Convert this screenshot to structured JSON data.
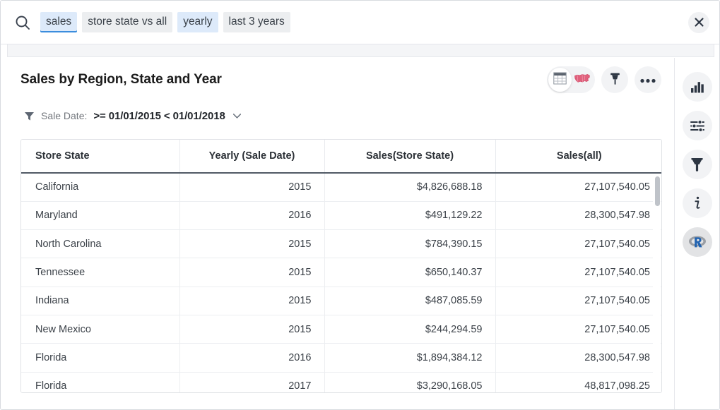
{
  "search": {
    "icon": "search-icon",
    "chips": [
      {
        "label": "sales",
        "style": "active"
      },
      {
        "label": "store state vs all",
        "style": "gray"
      },
      {
        "label": "yearly",
        "style": "blue"
      },
      {
        "label": "last 3 years",
        "style": "gray"
      }
    ],
    "close_label": "×"
  },
  "viz": {
    "title": "Sales by Region, State and Year",
    "actions": {
      "table_icon": "table-icon",
      "map_icon": "us-map-icon",
      "pin_icon": "pin-icon",
      "more_icon": "more-options-icon"
    }
  },
  "filter": {
    "icon": "funnel-icon",
    "label": "Sale Date:",
    "value": ">= 01/01/2015 < 01/01/2018",
    "caret": "chevron-down-icon"
  },
  "sidebar": {
    "items": [
      {
        "name": "chart-icon",
        "label": "chart"
      },
      {
        "name": "settings-sliders-icon",
        "label": "settings"
      },
      {
        "name": "filter-funnel-icon",
        "label": "filter"
      },
      {
        "name": "info-icon",
        "label": "info"
      },
      {
        "name": "r-language-icon",
        "label": "R"
      }
    ]
  },
  "table": {
    "columns": [
      "Store State",
      "Yearly (Sale Date)",
      "Sales(Store State)",
      "Sales(all)"
    ],
    "rows": [
      [
        "California",
        "2015",
        "$4,826,688.18",
        "27,107,540.05"
      ],
      [
        "Maryland",
        "2016",
        "$491,129.22",
        "28,300,547.98"
      ],
      [
        "North Carolina",
        "2015",
        "$784,390.15",
        "27,107,540.05"
      ],
      [
        "Tennessee",
        "2015",
        "$650,140.37",
        "27,107,540.05"
      ],
      [
        "Indiana",
        "2015",
        "$487,085.59",
        "27,107,540.05"
      ],
      [
        "New Mexico",
        "2015",
        "$244,294.59",
        "27,107,540.05"
      ],
      [
        "Florida",
        "2016",
        "$1,894,384.12",
        "28,300,547.98"
      ],
      [
        "Florida",
        "2017",
        "$3,290,168.05",
        "48,817,098.25"
      ]
    ]
  },
  "colors": {
    "chip_blue": "#ddeafa",
    "chip_gray": "#eceef0",
    "accent_blue": "#3b8ddd",
    "header_rule": "#515a66",
    "map_red": "#e0607c"
  }
}
